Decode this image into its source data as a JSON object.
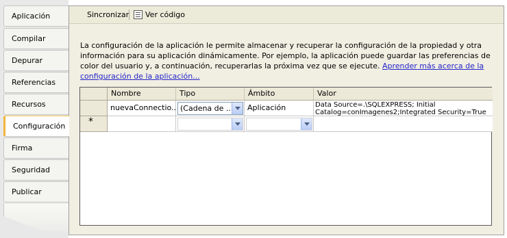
{
  "tabs": [
    {
      "label": "Aplicación"
    },
    {
      "label": "Compilar"
    },
    {
      "label": "Depurar"
    },
    {
      "label": "Referencias"
    },
    {
      "label": "Recursos"
    },
    {
      "label": "Configuración",
      "active": true
    },
    {
      "label": "Firma"
    },
    {
      "label": "Seguridad"
    },
    {
      "label": "Publicar"
    }
  ],
  "toolbar": {
    "sync_label": "Sincronizar",
    "view_code_label": "Ver código",
    "view_code_icon": "code-file-icon"
  },
  "description": {
    "text": "La configuración de la aplicación le permite almacenar y recuperar la configuración de la propiedad y otra información para su aplicación dinámicamente. Por ejemplo, la aplicación puede guardar las preferencias de color del usuario y, a continuación, recuperarlas la próxima vez que se ejecute.",
    "link": "Aprender más acerca de la configuración de la aplicación..."
  },
  "grid": {
    "columns": [
      "Nombre",
      "Tipo",
      "Ámbito",
      "Valor"
    ],
    "rows": [
      {
        "name": "nuevaConnectio...",
        "type": "(Cadena de ...",
        "scope": "Aplicación",
        "value": "Data Source=.\\SQLEXPRESS; Initial Catalog=conImagenes2;Integrated Security=True"
      }
    ],
    "new_row_marker": "*"
  },
  "colors": {
    "active_tab_accent": "#f3b43c",
    "link": "#2424c8",
    "panel_bg": "#f1efe2"
  }
}
